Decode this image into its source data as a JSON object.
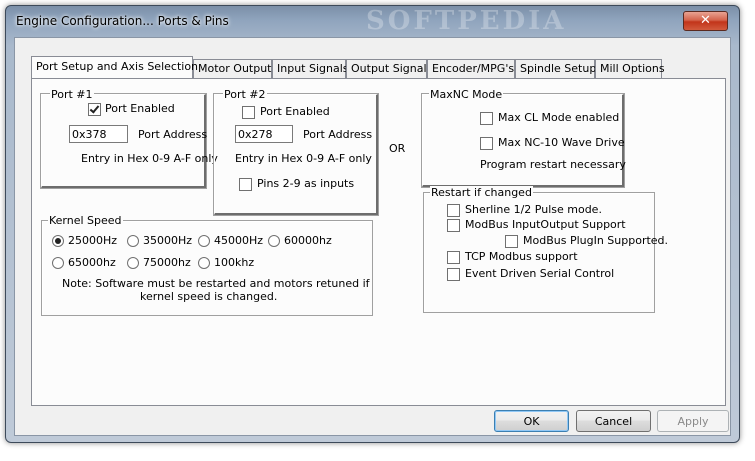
{
  "window": {
    "title": "Engine Configuration... Ports & Pins",
    "close_label": "✕",
    "watermark": "SOFTPEDIA"
  },
  "tabs": [
    {
      "label": "Port Setup and Axis Selection"
    },
    {
      "label": "Motor Outputs"
    },
    {
      "label": "Input Signals"
    },
    {
      "label": "Output Signals"
    },
    {
      "label": "Encoder/MPG's"
    },
    {
      "label": "Spindle Setup"
    },
    {
      "label": "Mill Options"
    }
  ],
  "port1": {
    "legend": "Port #1",
    "enabled_label": "Port Enabled",
    "enabled": true,
    "address_value": "0x378",
    "address_label": "Port Address",
    "hint": "Entry in Hex 0-9 A-F only"
  },
  "port2": {
    "legend": "Port #2",
    "enabled_label": "Port Enabled",
    "enabled": false,
    "address_value": "0x278",
    "address_label": "Port Address",
    "hint": "Entry in Hex 0-9 A-F only",
    "pins_label": "Pins 2-9 as inputs",
    "pins_checked": false
  },
  "or_label": "OR",
  "maxnc": {
    "legend": "MaxNC Mode",
    "cl_label": "Max CL Mode enabled",
    "nc10_label": "Max NC-10 Wave Drive",
    "note": "Program restart necessary"
  },
  "kernel": {
    "legend": "Kernel Speed",
    "options": [
      "25000Hz",
      "35000Hz",
      "45000Hz",
      "60000hz",
      "65000hz",
      "75000hz",
      "100khz"
    ],
    "selected": "25000Hz",
    "note1": "Note: Software must be restarted and motors retuned if",
    "note2": "kernel speed is changed."
  },
  "restart": {
    "legend": "Restart if changed",
    "sherline": "Sherline 1/2 Pulse mode.",
    "modbus_io": "ModBus InputOutput Support",
    "modbus_plugin": "ModBus PlugIn Supported.",
    "tcp": "TCP Modbus support",
    "event": "Event Driven Serial Control"
  },
  "buttons": {
    "ok": "OK",
    "cancel": "Cancel",
    "apply": "Apply"
  }
}
